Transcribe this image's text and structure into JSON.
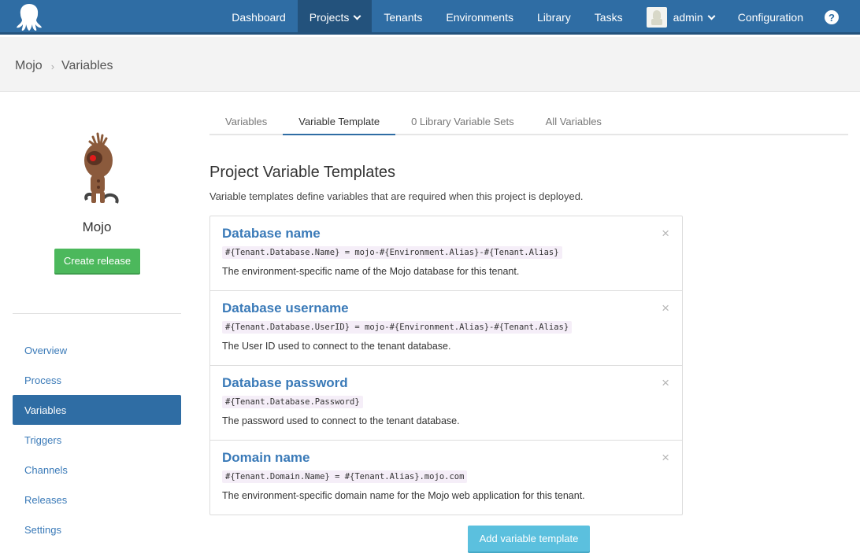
{
  "topnav": {
    "items": [
      {
        "label": "Dashboard"
      },
      {
        "label": "Projects"
      },
      {
        "label": "Tenants"
      },
      {
        "label": "Environments"
      },
      {
        "label": "Library"
      },
      {
        "label": "Tasks"
      }
    ],
    "user": "admin",
    "configuration": "Configuration",
    "help": "?"
  },
  "breadcrumb": {
    "project": "Mojo",
    "page": "Variables"
  },
  "sidebar": {
    "project_name": "Mojo",
    "create_release": "Create release",
    "items": [
      {
        "label": "Overview"
      },
      {
        "label": "Process"
      },
      {
        "label": "Variables"
      },
      {
        "label": "Triggers"
      },
      {
        "label": "Channels"
      },
      {
        "label": "Releases"
      },
      {
        "label": "Settings"
      }
    ]
  },
  "tabs": [
    {
      "label": "Variables"
    },
    {
      "label": "Variable Template"
    },
    {
      "label": "0 Library Variable Sets"
    },
    {
      "label": "All Variables"
    }
  ],
  "main": {
    "title": "Project Variable Templates",
    "description": "Variable templates define variables that are required when this project is deployed.",
    "templates": [
      {
        "name": "Database name",
        "code": "#{Tenant.Database.Name} = mojo-#{Environment.Alias}-#{Tenant.Alias}",
        "description": "The environment-specific name of the Mojo database for this tenant."
      },
      {
        "name": "Database username",
        "code": "#{Tenant.Database.UserID} = mojo-#{Environment.Alias}-#{Tenant.Alias}",
        "description": "The User ID used to connect to the tenant database."
      },
      {
        "name": "Database password",
        "code": "#{Tenant.Database.Password}",
        "description": "The password used to connect to the tenant database."
      },
      {
        "name": "Domain name",
        "code": "#{Tenant.Domain.Name} = #{Tenant.Alias}.mojo.com",
        "description": "The environment-specific domain name for the Mojo web application for this tenant."
      }
    ],
    "remove_glyph": "×",
    "add_button": "Add variable template"
  },
  "colors": {
    "nav": "#2f6da4",
    "nav_active": "#23527c",
    "link": "#3a7ab8",
    "green": "#4cb85c",
    "info": "#5bc0de"
  }
}
